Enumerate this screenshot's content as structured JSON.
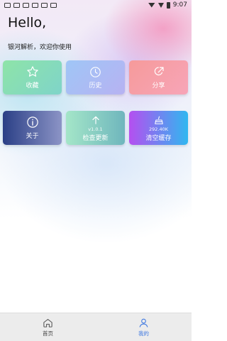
{
  "status_bar": {
    "time": "9:07"
  },
  "header": {
    "greeting": "Hello,",
    "welcome": "银河解析，欢迎你使用"
  },
  "cards_row1": [
    {
      "label": "收藏",
      "icon": "star-icon"
    },
    {
      "label": "历史",
      "icon": "clock-icon"
    },
    {
      "label": "分享",
      "icon": "share-icon"
    }
  ],
  "cards_row2": [
    {
      "label": "关于",
      "icon": "info-icon"
    },
    {
      "label": "检查更新",
      "version": "v1.0.1",
      "icon": "arrow-up-icon"
    },
    {
      "label": "清空缓存",
      "size": "292.40K",
      "icon": "broom-icon"
    }
  ],
  "tabbar": {
    "home": "首页",
    "mine": "我的"
  },
  "colors": {
    "active_tab": "#3f78e0"
  }
}
